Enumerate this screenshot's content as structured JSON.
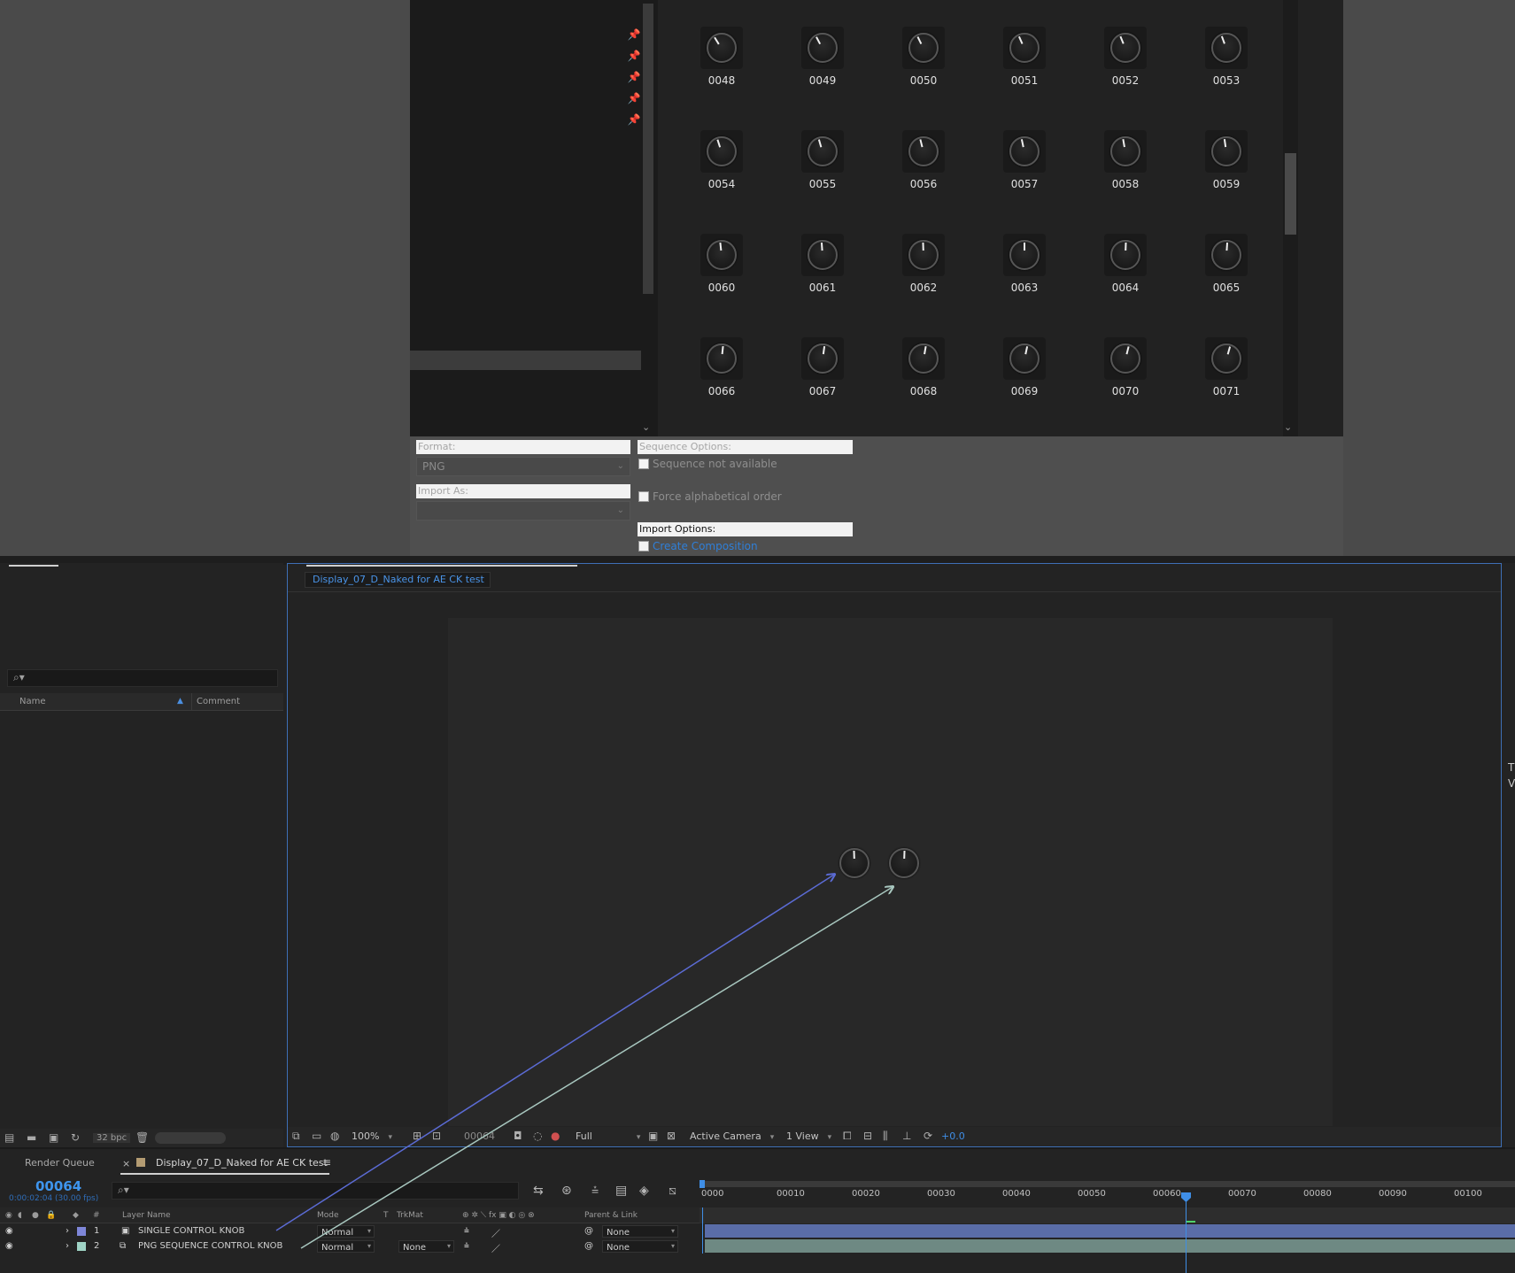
{
  "dialog": {
    "thumbnails": [
      {
        "label": "0048",
        "rot": -32
      },
      {
        "label": "0049",
        "rot": -28
      },
      {
        "label": "0050",
        "rot": -26
      },
      {
        "label": "0051",
        "rot": -24
      },
      {
        "label": "0052",
        "rot": -22
      },
      {
        "label": "0053",
        "rot": -20
      },
      {
        "label": "0054",
        "rot": -18
      },
      {
        "label": "0055",
        "rot": -16
      },
      {
        "label": "0056",
        "rot": -14
      },
      {
        "label": "0057",
        "rot": -12
      },
      {
        "label": "0058",
        "rot": -10
      },
      {
        "label": "0059",
        "rot": -8
      },
      {
        "label": "0060",
        "rot": -6
      },
      {
        "label": "0061",
        "rot": -4
      },
      {
        "label": "0062",
        "rot": -2
      },
      {
        "label": "0063",
        "rot": 0
      },
      {
        "label": "0064",
        "rot": 2
      },
      {
        "label": "0065",
        "rot": 4
      },
      {
        "label": "0066",
        "rot": 6
      },
      {
        "label": "0067",
        "rot": 8
      },
      {
        "label": "0068",
        "rot": 10
      },
      {
        "label": "0069",
        "rot": 12
      },
      {
        "label": "0070",
        "rot": 14
      },
      {
        "label": "0071",
        "rot": 16
      }
    ],
    "format_label": "Format:",
    "format_value": "PNG",
    "import_as_label": "Import As:",
    "import_as_value": "",
    "sequence_options_label": "Sequence Options:",
    "sequence_not_available": "Sequence not available",
    "force_alphabetical": "Force alphabetical order",
    "import_options_label": "Import Options:",
    "create_composition": "Create Composition"
  },
  "project": {
    "search_placeholder": "",
    "col_name": "Name",
    "col_comment": "Comment",
    "bpc": "32 bpc"
  },
  "comp": {
    "subtab": "Display_07_D_Naked for AE CK test",
    "zoom": "100%",
    "timecode": "00064",
    "resolution": "Full",
    "camera": "Active Camera",
    "views": "1 View",
    "exposure": "+0.0"
  },
  "timeline": {
    "render_queue": "Render Queue",
    "tab": "Display_07_D_Naked for AE CK test",
    "timecode": "00064",
    "sub_timecode": "0:00:02:04 (30.00 fps)",
    "headers": {
      "hash": "#",
      "layer_name": "Layer Name",
      "mode": "Mode",
      "t": "T",
      "trkmat": "TrkMat",
      "parent": "Parent & Link"
    },
    "layers": [
      {
        "num": "1",
        "name": "SINGLE CONTROL KNOB",
        "mode": "Normal",
        "trkmat": "",
        "parent": "None",
        "color": "#7e86d8"
      },
      {
        "num": "2",
        "name": "PNG SEQUENCE CONTROL KNOB",
        "mode": "Normal",
        "trkmat": "None",
        "parent": "None",
        "color": "#9fd3c5"
      }
    ],
    "ruler_labels": [
      "0000",
      "00010",
      "00020",
      "00030",
      "00040",
      "00050",
      "00060",
      "00070",
      "00080",
      "00090",
      "00100"
    ]
  },
  "colors": {
    "accent": "#3f8ee6",
    "layer1_bar": "#5a6da8",
    "layer2_bar": "#6e8983",
    "arrow1": "#5b6bd4",
    "arrow2": "#a8c7bf"
  }
}
